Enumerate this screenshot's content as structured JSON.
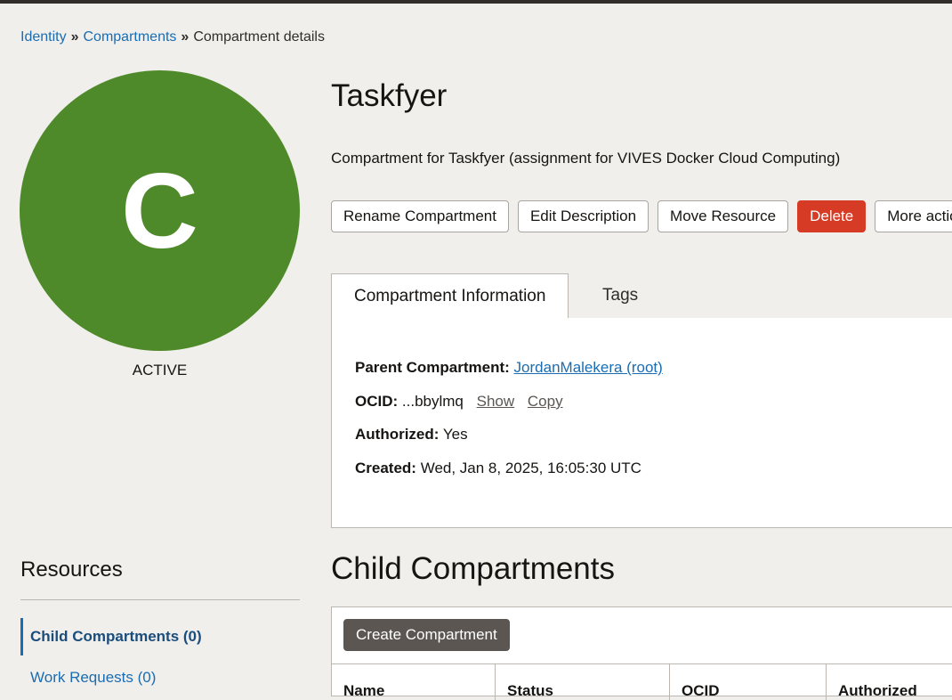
{
  "breadcrumb": {
    "identity": "Identity",
    "compartments": "Compartments",
    "current": "Compartment details",
    "separator": "»"
  },
  "avatar": {
    "letter": "C",
    "status": "ACTIVE",
    "color": "#4f8a2a"
  },
  "header": {
    "title": "Taskfyer",
    "description": "Compartment for Taskfyer (assignment for VIVES Docker Cloud Computing)"
  },
  "actions": {
    "rename": "Rename Compartment",
    "edit": "Edit Description",
    "move": "Move Resource",
    "delete": "Delete",
    "more": "More actions"
  },
  "tabs": {
    "info": "Compartment Information",
    "tags": "Tags"
  },
  "info": {
    "parent_label": "Parent Compartment:",
    "parent_value": "JordanMalekera (root)",
    "ocid_label": "OCID:",
    "ocid_value": "...bbylmq",
    "ocid_show": "Show",
    "ocid_copy": "Copy",
    "authorized_label": "Authorized:",
    "authorized_value": "Yes",
    "created_label": "Created:",
    "created_value": "Wed, Jan 8, 2025, 16:05:30 UTC"
  },
  "resources": {
    "heading": "Resources",
    "items": [
      {
        "label": "Child Compartments (0)"
      },
      {
        "label": "Work Requests (0)"
      }
    ]
  },
  "child": {
    "heading": "Child Compartments",
    "create_button": "Create Compartment",
    "columns": [
      "Name",
      "Status",
      "OCID",
      "Authorized"
    ]
  },
  "colors": {
    "accent": "#1a6db3",
    "danger": "#d63b25",
    "active_green": "#4f8a2a"
  }
}
